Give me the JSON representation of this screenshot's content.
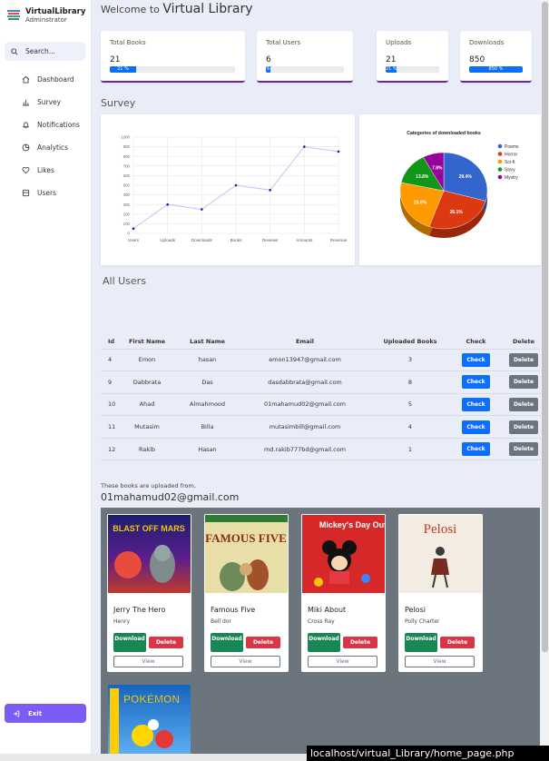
{
  "sidebar": {
    "brand_title": "VirtualLibrary",
    "brand_subtitle": "Adminstrator",
    "search_label": "Search...",
    "items": [
      {
        "label": "Dashboard",
        "icon": "home-icon"
      },
      {
        "label": "Survey",
        "icon": "bar-chart-icon"
      },
      {
        "label": "Notifications",
        "icon": "bell-icon"
      },
      {
        "label": "Analytics",
        "icon": "pie-chart-icon"
      },
      {
        "label": "Likes",
        "icon": "heart-icon"
      },
      {
        "label": "Users",
        "icon": "users-icon"
      }
    ],
    "exit_label": "Exit"
  },
  "header": {
    "welcome_prefix": "Welcome to",
    "welcome_name": "Virtual Library"
  },
  "stats": [
    {
      "label": "Total Books",
      "value": "21",
      "percent_label": "21 %",
      "fraction": 0.21
    },
    {
      "label": "Total Users",
      "value": "6",
      "percent_label": "6",
      "fraction": 0.06
    },
    {
      "label": "Uploads",
      "value": "21",
      "percent_label": "21 %",
      "fraction": 0.21
    },
    {
      "label": "Downloads",
      "value": "850",
      "percent_label": "850 %",
      "fraction": 1.0
    }
  ],
  "sections": {
    "survey": "Survey",
    "all_users": "All Users"
  },
  "chart_data": [
    {
      "type": "line",
      "x": [
        "Users",
        "Uploads",
        "Downloads",
        "Books",
        "Reviews",
        "Amounts",
        "Revenue"
      ],
      "values": [
        50,
        300,
        250,
        500,
        450,
        900,
        850
      ],
      "ylim": [
        0,
        1000
      ],
      "yticks": [
        0,
        100,
        200,
        300,
        400,
        500,
        600,
        700,
        800,
        900,
        1000
      ],
      "grid": true,
      "color": "#c5c3f5",
      "point_color": "#1a1aa8"
    },
    {
      "type": "pie",
      "title": "Categories of downloaded books",
      "legend_position": "right",
      "slices": [
        {
          "label": "Poems",
          "value": 29.4,
          "display": "29.4%",
          "color": "#3366cc"
        },
        {
          "label": "Horror",
          "value": 26.1,
          "display": "26.1%",
          "color": "#dc3912"
        },
        {
          "label": "Sci-fi",
          "value": 23.0,
          "display": "23.0%",
          "color": "#ff9900"
        },
        {
          "label": "Story",
          "value": 13.8,
          "display": "13.8%",
          "color": "#109618"
        },
        {
          "label": "Mystry",
          "value": 7.8,
          "display": "7.8%",
          "color": "#990099"
        }
      ]
    }
  ],
  "users_table": {
    "columns": [
      "Id",
      "First Name",
      "Last Name",
      "Email",
      "Uploaded Books",
      "Check",
      "Delete"
    ],
    "rows": [
      {
        "id": "4",
        "first": "Emon",
        "last": "hasan",
        "email": "emon13947@gmail.com",
        "uploaded": "3"
      },
      {
        "id": "9",
        "first": "Dabbrata",
        "last": "Das",
        "email": "dasdabbrata@gmail.com",
        "uploaded": "8"
      },
      {
        "id": "10",
        "first": "Ahad",
        "last": "Almahmood",
        "email": "01mahamud02@gmail.com",
        "uploaded": "5"
      },
      {
        "id": "11",
        "first": "Mutasim",
        "last": "Billa",
        "email": "mutasimbill@gmail.com",
        "uploaded": "4"
      },
      {
        "id": "12",
        "first": "Rakib",
        "last": "Hasan",
        "email": "md.rakib777bd@gmail.com",
        "uploaded": "1"
      }
    ],
    "check_label": "Check",
    "delete_label": "Delete"
  },
  "uploads": {
    "caption": "These books are uploaded from,",
    "email": "01mahamud02@gmail.com",
    "download_label": "Download",
    "delete_label": "Delete",
    "view_label": "View",
    "books": [
      {
        "title": "Jerry The Hero",
        "author": "Henry",
        "cover_text": "BLAST OFF MARS"
      },
      {
        "title": "Famous Five",
        "author": "Bell dor",
        "cover_text": "FAMOUS FIVE"
      },
      {
        "title": "Miki About",
        "author": "Cross Ray",
        "cover_text": "Mickey's Day Out"
      },
      {
        "title": "Pelosi",
        "author": "Polly Charter",
        "cover_text": "Pelosi"
      },
      {
        "title": "",
        "author": "",
        "cover_text": "POKÉMON"
      }
    ]
  },
  "status_url": "localhost/virtual_Library/home_page.php"
}
